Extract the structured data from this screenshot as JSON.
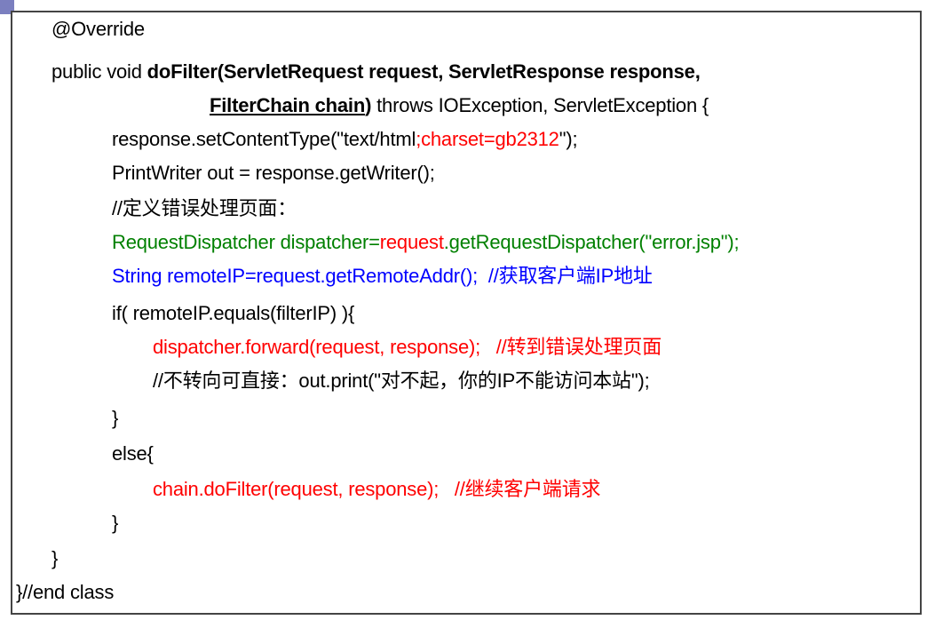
{
  "code": {
    "line1": "@Override",
    "line2_a": "public void ",
    "line2_b": "doFilter(ServletRequest request, ServletResponse response,",
    "line3_a": "FilterChain chain",
    "line3_b": ")",
    "line3_c": " throws IOException, ServletException {",
    "line4_a": "response.setContentType(\"text/html",
    "line4_b": ";charset=gb2312",
    "line4_c": "\");",
    "line5": "PrintWriter out = response.getWriter();",
    "line6": "//定义错误处理页面：",
    "line7_a": "RequestDispatcher dispatcher=",
    "line7_b": "request",
    "line7_c": ".getRequestDispatcher(\"error.jsp\");",
    "line8": "String remoteIP=request.getRemoteAddr();  //获取客户端IP地址",
    "line9": "if( remoteIP.equals(filterIP) ){",
    "line10": "dispatcher.forward(request, response);   //转到错误处理页面",
    "line11": "//不转向可直接：out.print(\"对不起，你的IP不能访问本站\");",
    "line12": "}",
    "line13": "else{",
    "line14": "chain.doFilter(request, response);   //继续客户端请求",
    "line15": "}",
    "line16": "}",
    "line17": "}//end class"
  },
  "colors": {
    "red": "#ff0000",
    "green": "#008000",
    "blue": "#0000ff",
    "corner": "#7b7fbf"
  }
}
